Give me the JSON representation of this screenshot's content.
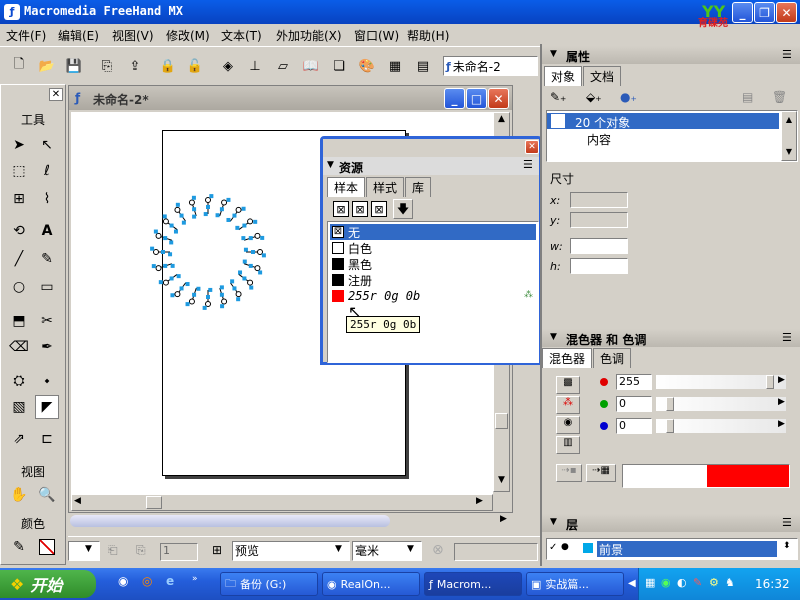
{
  "window": {
    "title": "Macromedia FreeHand MX"
  },
  "logo": {
    "text": "育碟苑"
  },
  "menu": [
    "文件(F)",
    "编辑(E)",
    "视图(V)",
    "修改(M)",
    "文本(T)",
    "外加功能(X)",
    "窗口(W)",
    "帮助(H)"
  ],
  "toolbar": {
    "document_select": "未命名-2"
  },
  "tools": {
    "title": "工具",
    "view_title": "视图",
    "color_title": "颜色"
  },
  "document": {
    "title": "未命名-2*"
  },
  "assets": {
    "title": "资源",
    "tabs": [
      "样本",
      "样式",
      "库"
    ],
    "swatches": [
      {
        "name": "无",
        "color": "none",
        "selected": true
      },
      {
        "name": "白色",
        "color": "#ffffff"
      },
      {
        "name": "黑色",
        "color": "#000000"
      },
      {
        "name": "注册",
        "color": "#000000"
      },
      {
        "name": "255r 0g 0b",
        "color": "#ff0000"
      }
    ],
    "tooltip": "255r 0g 0b"
  },
  "properties": {
    "title": "属性",
    "tabs": [
      "对象",
      "文档"
    ],
    "tree": {
      "root": "20 个对象",
      "child": "内容"
    },
    "dimensions_label": "尺寸",
    "fields": [
      "x:",
      "y:",
      "w:",
      "h:"
    ]
  },
  "mixer": {
    "title": "混色器 和 色调",
    "tabs": [
      "混色器",
      "色调"
    ],
    "channels": [
      {
        "value": "255",
        "color": "#e00000",
        "fill": 1.0
      },
      {
        "value": "0",
        "color": "#00a000",
        "fill": 0.0
      },
      {
        "value": "0",
        "color": "#0000d0",
        "fill": 0.0
      }
    ],
    "preview_color": "#ff0000"
  },
  "layers": {
    "title": "层",
    "item": "前景"
  },
  "statusbar": {
    "page_value": "1",
    "view_mode": "预览",
    "units": "毫米"
  },
  "taskbar": {
    "start": "开始",
    "buttons": [
      "备份 (G:)",
      "RealOn...",
      "Macrom...",
      "实战篇..."
    ],
    "clock": "16:32"
  }
}
